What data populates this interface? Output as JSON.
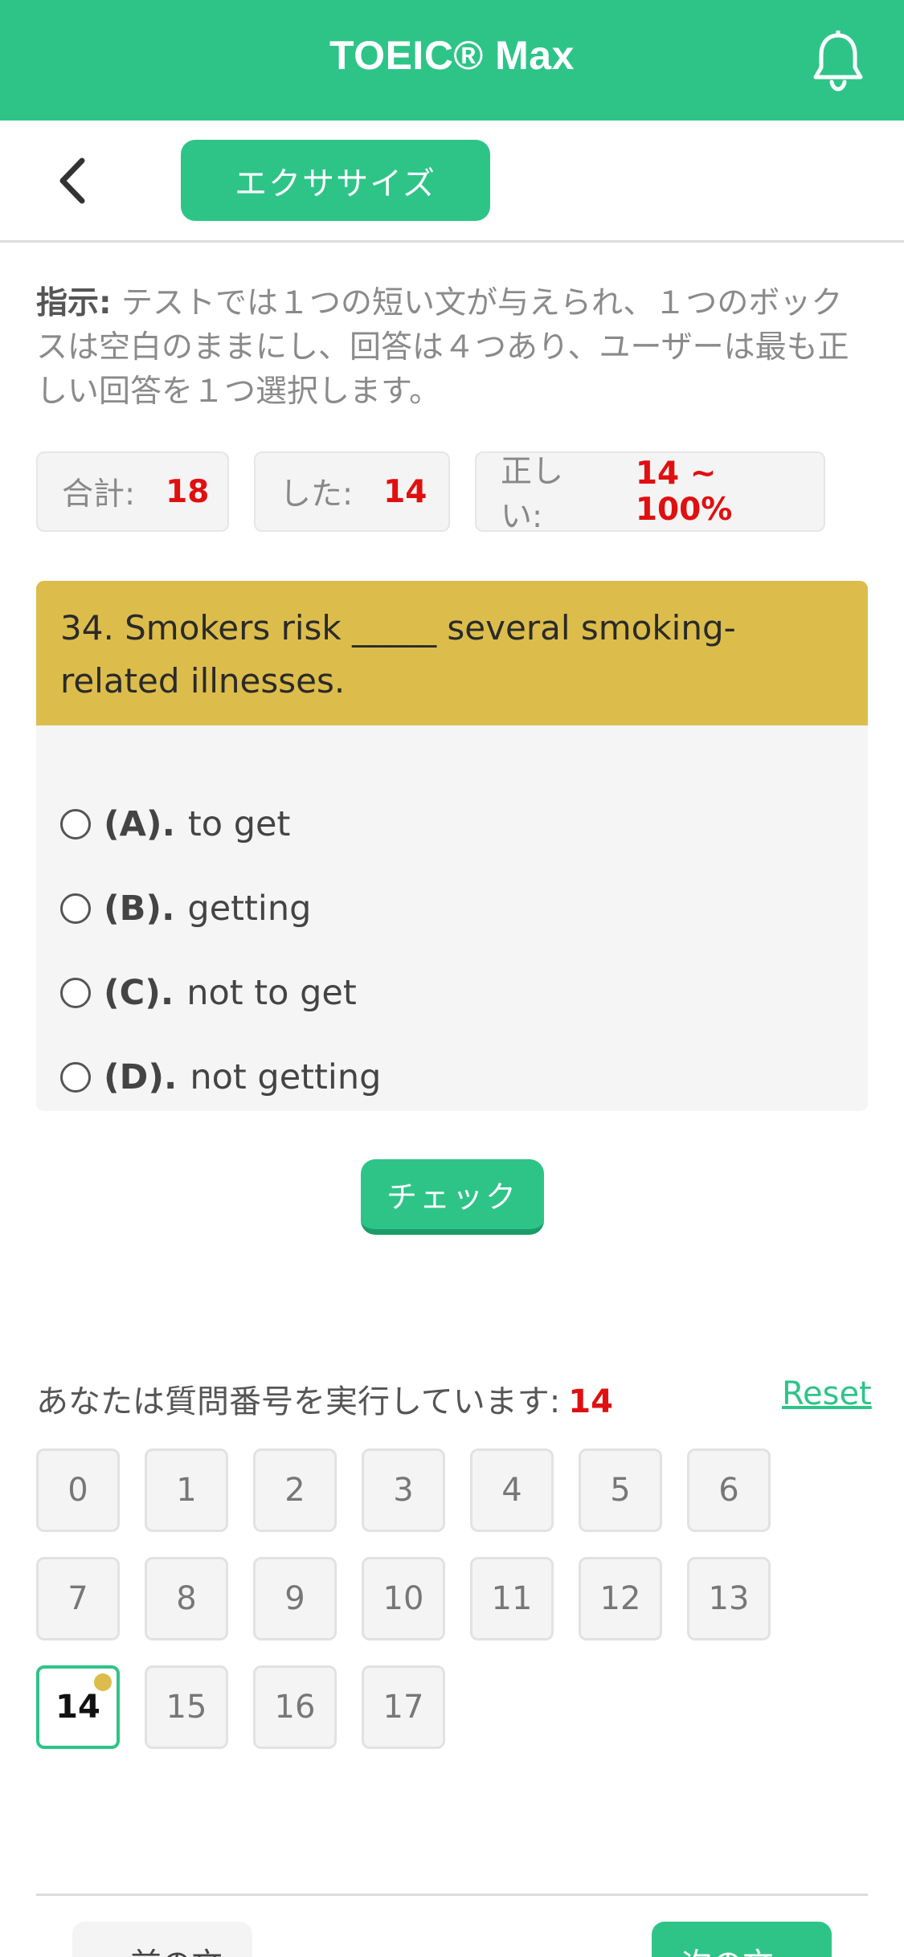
{
  "header": {
    "title": "TOEIC® Max",
    "bell_icon": "bell-icon"
  },
  "subbar": {
    "back_icon": "chevron-left-icon",
    "mode_label": "エクササイズ"
  },
  "instructions": {
    "label": "指示:",
    "text": " テストでは１つの短い文が与えられ、１つのボックスは空白のままにし、回答は４つあり、ユーザーは最も正しい回答を１つ選択します。"
  },
  "stats": {
    "total_label": "合計:",
    "total_value": "18",
    "done_label": "した:",
    "done_value": "14",
    "correct_label": "正しい:",
    "correct_value": "14 ~ 100%"
  },
  "question": {
    "text": "34. Smokers risk _____ several smoking-related illnesses.",
    "options": [
      {
        "letter": "(A).",
        "text": "to get"
      },
      {
        "letter": "(B).",
        "text": "getting"
      },
      {
        "letter": "(C).",
        "text": "not to get"
      },
      {
        "letter": "(D).",
        "text": "not getting"
      }
    ]
  },
  "check_label": "チェック",
  "progress": {
    "label": "あなたは質問番号を実行しています:",
    "current": "14",
    "reset_label": "Reset",
    "numbers": [
      "0",
      "1",
      "2",
      "3",
      "4",
      "5",
      "6",
      "7",
      "8",
      "9",
      "10",
      "11",
      "12",
      "13",
      "14",
      "15",
      "16",
      "17"
    ]
  },
  "nav": {
    "prev_label": "« 前の文",
    "next_label": "次の文 »"
  },
  "colors": {
    "accent": "#2ec488",
    "question_bg": "#dcbd4b",
    "highlight": "#e01010"
  }
}
